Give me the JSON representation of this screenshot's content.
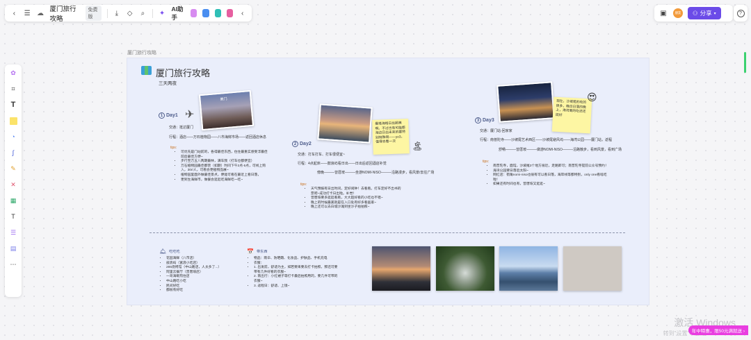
{
  "toolbar": {
    "title": "厦门旅行攻略",
    "plan_badge": "免费版",
    "ai_label": "AI助手"
  },
  "topright": {
    "avatar_text": "朋友",
    "share_label": "分享"
  },
  "frame_label": "厦门旅行攻略",
  "board": {
    "title": "厦门旅行攻略",
    "subtitle": "三天两夜",
    "day1": {
      "label": "Day1",
      "num": "1",
      "transport": "交通：抵达厦门",
      "trip": "行程：酒店——万石植物园——八市海鲜市场——返回酒店休息",
      "tips_label": "tips:",
      "tips": [
        "可优先是门站前的，各得最佳东西，住住最重实感受浮最佳前后最佳方便~",
        "步行至万五八两期最林，满车我（打车也都便宜）",
        "万石植物园最佳都营（如期）时间下午3点-5点，可线上购入，30r/人，可看会更植物品展~",
        "植物园里面外做最佳景点，便能可看在最近上看日落，",
        "更到生海鲜市，做餐会逛逛吃海鲜吃一吃~"
      ],
      "photo_caption": "美门"
    },
    "day2": {
      "label": "Day2",
      "num": "2",
      "transport": "交通：打车打车、打车很便宜~",
      "trip_head": "行程：4点起床——鼓浪屿看日出——日出后返回酒店补觉",
      "trip_tail": "傍晚———曾厝垵———坐游NOMI-NISO———沿路漫步，看风景/去往广场",
      "tips_label": "tips:",
      "tips": [
        "天气预报有日出时间，定好闹钟！去看看。打车定好不出书的票吧~成功打卡日出啦。补觉！",
        "曾厝垵要多逛逛看看，大大超好看的小吃也不错~",
        "晚上的时候最美就是在入口处有好多看画家~",
        "晚上还可以去白城沙滩到坐沙子拍拍照~"
      ],
      "sticky": "曼塔海格日出超美啊。不过也有可能都海边日出未来的要特别特殊啊——yo3，值得去看一次"
    },
    "day3": {
      "label": "Day3",
      "num": "3",
      "transport": "交通：厦门站-回家家",
      "trip_head": "行程：南普陀寺——沙坡尾艺术西区——沙坡尾避风坞——海湾公园——厦门站，返程",
      "trip_tail": "舒畅———曾厝垵———做游NOMI-NISO———沿路散步，看到风景，看到广场",
      "tips_label": "tips:",
      "tips": [
        "南普陀寺，面馆，沙坡尾3个地方很近，走路即可；南普陀寺提前公众号预约！",
        "海湾公园要日落后太阳~",
        "网红店：街角nomi-niso也很有可以看日落，海岸线等都特别，only one看啥吃啦！",
        "如果还有时间也有，曾厝垵又逛逛~"
      ],
      "sticky": "现在，沙坡尾的吃的很多，晚日日落的晚上，海湾离的吃还还挺好"
    },
    "bottom": {
      "food_title": "吃吃吃",
      "food": [
        "花园海鲜（八市店）",
        "鼓浪屿（富浪小吃店）",
        "285烧烤馆（中山路店，人太多了...）",
        "阿里云餐厅（曾厝垵店）",
        "一哥海蛎煎住店",
        "中山路吃小吃",
        "民间好吃",
        "都很有好吃"
      ],
      "pack_title": "带东西",
      "pack": [
        "物品：雨伞、防晒霜、化妆品、护肤品、手机充电",
        "衣服：",
        "1. 出发前，舒适为主，如若要来要去打卡拍照，那还可要带有几件好看的衣服~",
        "2. 南出行：小红裙子等打卡最后拍照用的，要几件可带的衣服~",
        "3. 返程日：舒适、上镜~"
      ]
    }
  },
  "watermark": {
    "line1": "激活 Windows",
    "line2": "转到\"设置\"以激活 Windows。"
  },
  "promo": "年中特惠，限50元满就送 ›"
}
